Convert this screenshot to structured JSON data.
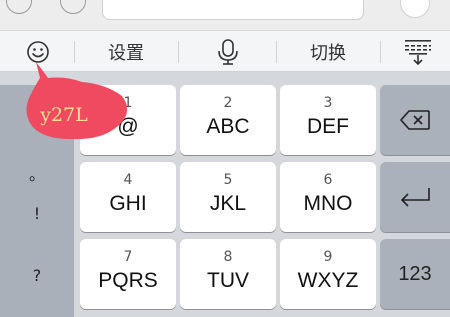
{
  "toolbar": {
    "settings_label": "设置",
    "switch_label": "切换"
  },
  "side_keys": [
    {
      "label": "。"
    },
    {
      "label": "!"
    },
    {
      "label": "?"
    }
  ],
  "keys": [
    {
      "num": "1",
      "label": "@"
    },
    {
      "num": "2",
      "label": "ABC"
    },
    {
      "num": "3",
      "label": "DEF"
    },
    {
      "num": "4",
      "label": "GHI"
    },
    {
      "num": "5",
      "label": "JKL"
    },
    {
      "num": "6",
      "label": "MNO"
    },
    {
      "num": "7",
      "label": "PQRS"
    },
    {
      "num": "8",
      "label": "TUV"
    },
    {
      "num": "9",
      "label": "WXYZ"
    }
  ],
  "function_keys": {
    "numbers_label": "123"
  },
  "overlay": {
    "tag_text": "y27L",
    "tag_color": "#ef4a60",
    "tag_text_color": "#f7e08a"
  },
  "icons": [
    "emoji-icon",
    "microphone-icon",
    "keyboard-hide-icon",
    "backspace-icon",
    "return-icon"
  ]
}
